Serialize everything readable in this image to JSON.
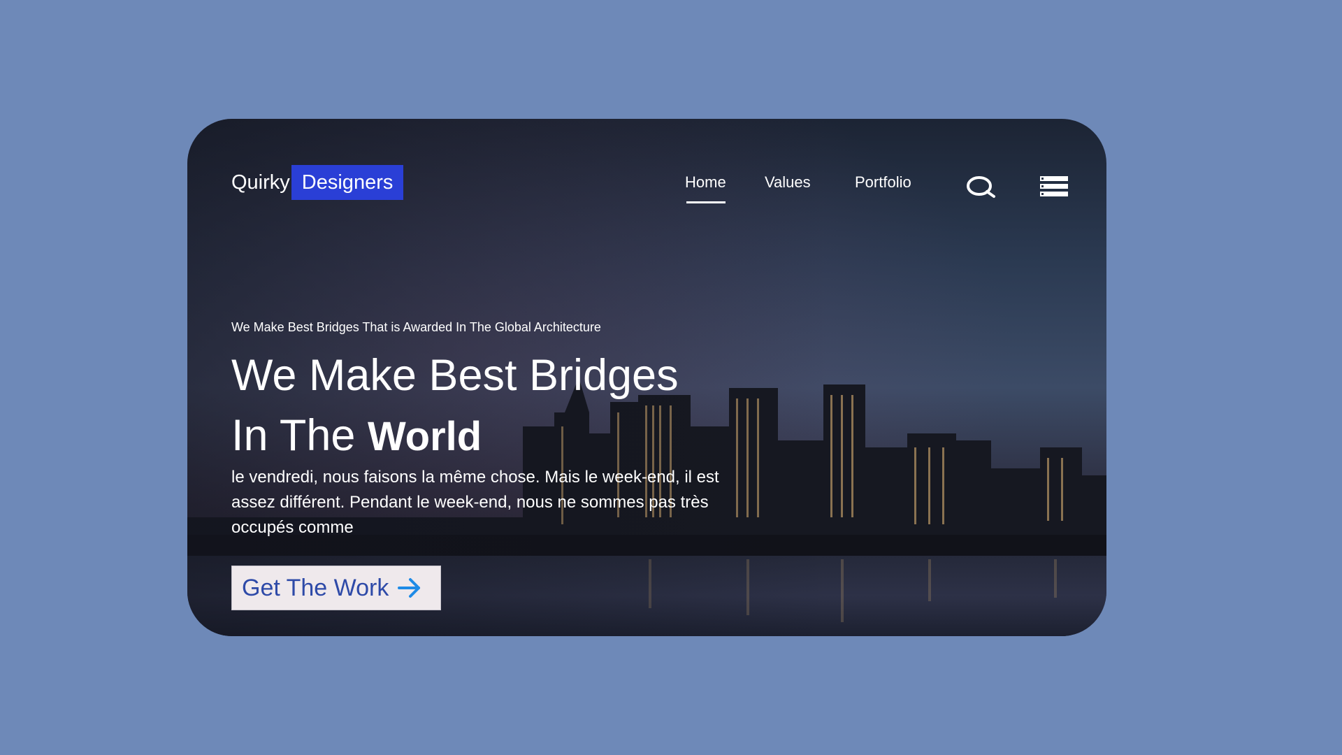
{
  "brand": {
    "name_part1": "Quirky",
    "name_part2": "Designers",
    "highlight_color": "#2a3fd6"
  },
  "nav": {
    "items": [
      {
        "label": "Home",
        "active": true
      },
      {
        "label": "Values",
        "active": false
      },
      {
        "label": "Portfolio",
        "active": false
      }
    ],
    "icons": [
      "search-icon",
      "menu-icon"
    ]
  },
  "hero": {
    "eyebrow": "We Make Best Bridges That is Awarded In The Global Architecture",
    "headline_line1": "We Make Best Bridges",
    "headline_line2_regular": "In The",
    "headline_line2_bold": "World",
    "description": "le vendredi, nous faisons la même chose. Mais le week-end, il est assez différent. Pendant le week-end, nous ne sommes pas très occupés comme",
    "cta_label": "Get The Work",
    "cta_icon": "arrow-right-icon"
  },
  "colors": {
    "page_background": "#6e89b8",
    "cta_background": "#efe9ec",
    "cta_text": "#2e4aa8",
    "cta_arrow": "#1f8be6"
  }
}
